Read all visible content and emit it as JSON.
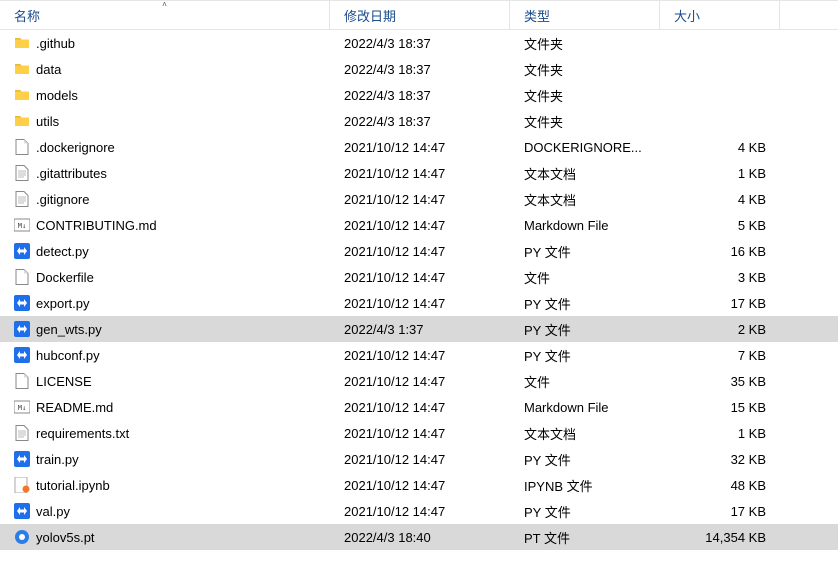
{
  "columns": {
    "name": "名称",
    "date": "修改日期",
    "type": "类型",
    "size": "大小"
  },
  "sort": {
    "column": "name",
    "dir": "asc"
  },
  "rows": [
    {
      "icon": "folder",
      "name": ".github",
      "date": "2022/4/3 18:37",
      "type": "文件夹",
      "size": "",
      "selected": false
    },
    {
      "icon": "folder",
      "name": "data",
      "date": "2022/4/3 18:37",
      "type": "文件夹",
      "size": "",
      "selected": false
    },
    {
      "icon": "folder",
      "name": "models",
      "date": "2022/4/3 18:37",
      "type": "文件夹",
      "size": "",
      "selected": false
    },
    {
      "icon": "folder",
      "name": "utils",
      "date": "2022/4/3 18:37",
      "type": "文件夹",
      "size": "",
      "selected": false
    },
    {
      "icon": "file",
      "name": ".dockerignore",
      "date": "2021/10/12 14:47",
      "type": "DOCKERIGNORE...",
      "size": "4 KB",
      "selected": false
    },
    {
      "icon": "txt",
      "name": ".gitattributes",
      "date": "2021/10/12 14:47",
      "type": "文本文档",
      "size": "1 KB",
      "selected": false
    },
    {
      "icon": "txt",
      "name": ".gitignore",
      "date": "2021/10/12 14:47",
      "type": "文本文档",
      "size": "4 KB",
      "selected": false
    },
    {
      "icon": "md",
      "name": "CONTRIBUTING.md",
      "date": "2021/10/12 14:47",
      "type": "Markdown File",
      "size": "5 KB",
      "selected": false
    },
    {
      "icon": "py",
      "name": "detect.py",
      "date": "2021/10/12 14:47",
      "type": "PY 文件",
      "size": "16 KB",
      "selected": false
    },
    {
      "icon": "file",
      "name": "Dockerfile",
      "date": "2021/10/12 14:47",
      "type": "文件",
      "size": "3 KB",
      "selected": false
    },
    {
      "icon": "py",
      "name": "export.py",
      "date": "2021/10/12 14:47",
      "type": "PY 文件",
      "size": "17 KB",
      "selected": false
    },
    {
      "icon": "py",
      "name": "gen_wts.py",
      "date": "2022/4/3 1:37",
      "type": "PY 文件",
      "size": "2 KB",
      "selected": true
    },
    {
      "icon": "py",
      "name": "hubconf.py",
      "date": "2021/10/12 14:47",
      "type": "PY 文件",
      "size": "7 KB",
      "selected": false
    },
    {
      "icon": "file",
      "name": "LICENSE",
      "date": "2021/10/12 14:47",
      "type": "文件",
      "size": "35 KB",
      "selected": false
    },
    {
      "icon": "md",
      "name": "README.md",
      "date": "2021/10/12 14:47",
      "type": "Markdown File",
      "size": "15 KB",
      "selected": false
    },
    {
      "icon": "txt",
      "name": "requirements.txt",
      "date": "2021/10/12 14:47",
      "type": "文本文档",
      "size": "1 KB",
      "selected": false
    },
    {
      "icon": "py",
      "name": "train.py",
      "date": "2021/10/12 14:47",
      "type": "PY 文件",
      "size": "32 KB",
      "selected": false
    },
    {
      "icon": "ipynb",
      "name": "tutorial.ipynb",
      "date": "2021/10/12 14:47",
      "type": "IPYNB 文件",
      "size": "48 KB",
      "selected": false
    },
    {
      "icon": "py",
      "name": "val.py",
      "date": "2021/10/12 14:47",
      "type": "PY 文件",
      "size": "17 KB",
      "selected": false
    },
    {
      "icon": "pt",
      "name": "yolov5s.pt",
      "date": "2022/4/3 18:40",
      "type": "PT 文件",
      "size": "14,354 KB",
      "selected": true
    }
  ]
}
